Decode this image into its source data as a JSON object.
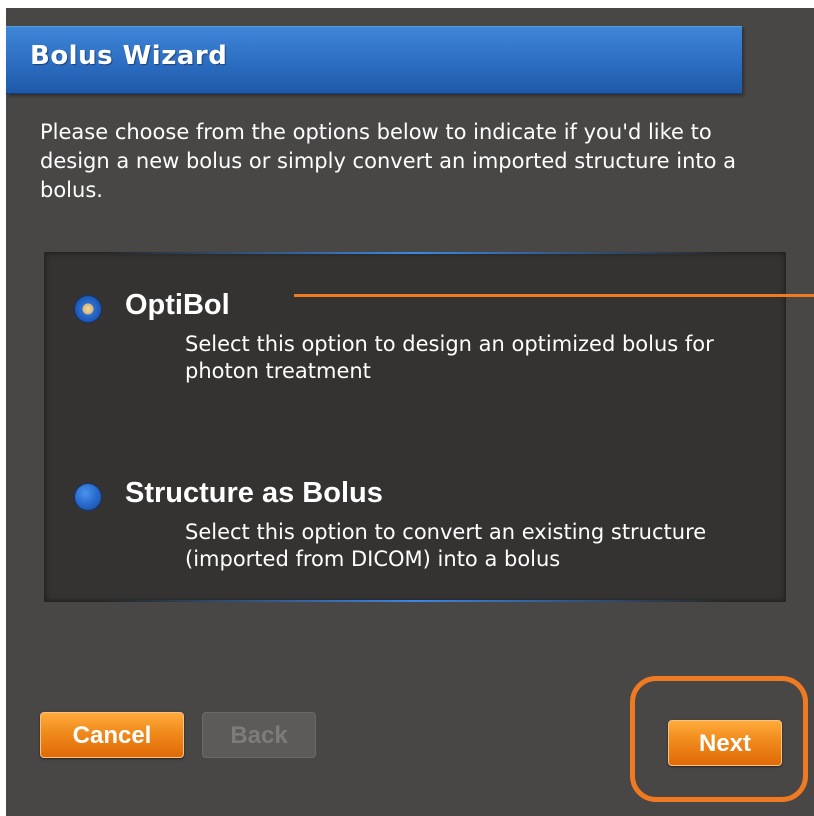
{
  "dialog": {
    "title": "Bolus Wizard",
    "intro": "Please choose from the options below to indicate if you'd like to design a new bolus or simply convert an imported structure into a bolus."
  },
  "options": [
    {
      "label": "OptiBol",
      "description": "Select this option to design an optimized bolus for photon treatment",
      "selected": true
    },
    {
      "label": "Structure as Bolus",
      "description": "Select this option to convert an existing structure (imported from DICOM) into a bolus",
      "selected": false
    }
  ],
  "buttons": {
    "cancel": "Cancel",
    "back": "Back",
    "next": "Next",
    "back_enabled": false
  },
  "colors": {
    "panel_bg": "#484746",
    "title_bar": "#2c6dc2",
    "accent_orange": "#f07a22",
    "button_orange": "#f08a1c"
  },
  "icons": {
    "selected_radio": "radio-selected-icon",
    "unselected_radio": "radio-unselected-icon"
  }
}
